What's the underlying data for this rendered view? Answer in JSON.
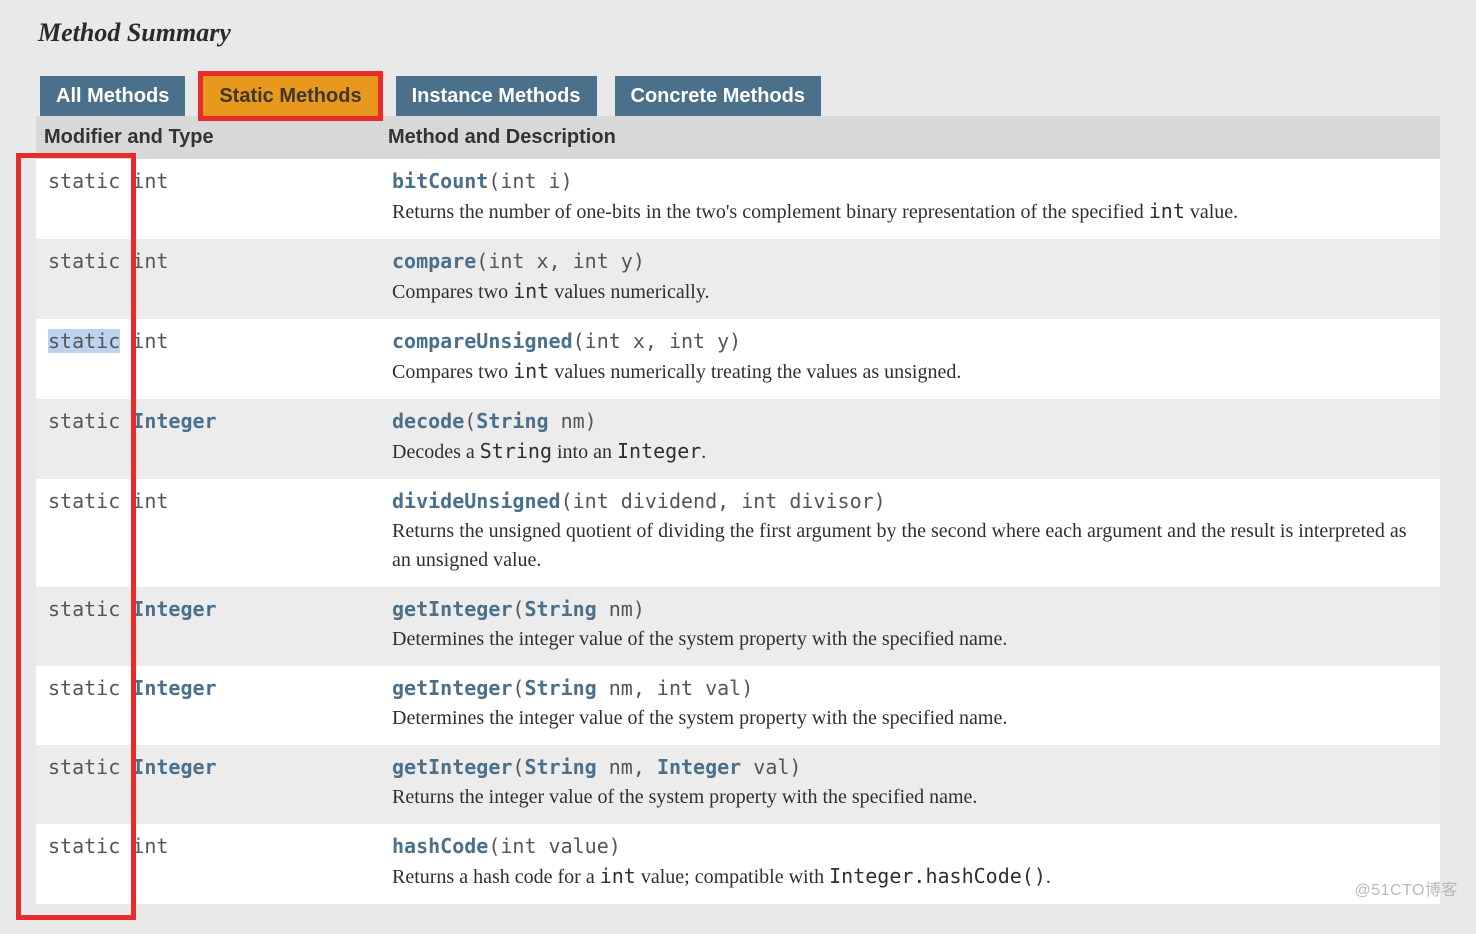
{
  "title": "Method Summary",
  "tabs": [
    {
      "label": "All Methods",
      "active": false
    },
    {
      "label": "Static Methods",
      "active": true,
      "highlight": true
    },
    {
      "label": "Instance Methods",
      "active": false
    },
    {
      "label": "Concrete Methods",
      "active": false
    }
  ],
  "columns": {
    "modifier": "Modifier and Type",
    "method": "Method and Description"
  },
  "rows": [
    {
      "modifier_static": "static",
      "modifier_type": "int",
      "type_is_link": false,
      "method_name": "bitCount",
      "params_html": "(int i)",
      "description_html": "Returns the number of one-bits in the two's complement binary representation of the specified <code>int</code> value."
    },
    {
      "modifier_static": "static",
      "modifier_type": "int",
      "type_is_link": false,
      "method_name": "compare",
      "params_html": "(int x, int y)",
      "description_html": "Compares two <code>int</code> values numerically."
    },
    {
      "modifier_static": "static",
      "static_selected": true,
      "modifier_type": "int",
      "type_is_link": false,
      "method_name": "compareUnsigned",
      "params_html": "(int x, int y)",
      "description_html": "Compares two <code>int</code> values numerically treating the values as unsigned."
    },
    {
      "modifier_static": "static",
      "modifier_type": "Integer",
      "type_is_link": true,
      "method_name": "decode",
      "params_html": "(<span class=\"ptype link\">String</span> nm)",
      "description_html": "Decodes a <code>String</code> into an <code>Integer</code>."
    },
    {
      "modifier_static": "static",
      "modifier_type": "int",
      "type_is_link": false,
      "method_name": "divideUnsigned",
      "params_html": "(int dividend, int divisor)",
      "description_html": "Returns the unsigned quotient of dividing the first argument by the second where each argument and the result is interpreted as an unsigned value."
    },
    {
      "modifier_static": "static",
      "modifier_type": "Integer",
      "type_is_link": true,
      "method_name": "getInteger",
      "params_html": "(<span class=\"ptype link\">String</span> nm)",
      "description_html": "Determines the integer value of the system property with the specified name."
    },
    {
      "modifier_static": "static",
      "modifier_type": "Integer",
      "type_is_link": true,
      "method_name": "getInteger",
      "params_html": "(<span class=\"ptype link\">String</span> nm, int val)",
      "description_html": "Determines the integer value of the system property with the specified name."
    },
    {
      "modifier_static": "static",
      "modifier_type": "Integer",
      "type_is_link": true,
      "method_name": "getInteger",
      "params_html": "(<span class=\"ptype link\">String</span> nm, <span class=\"ptype link\">Integer</span> val)",
      "description_html": "Returns the integer value of the system property with the specified name."
    },
    {
      "modifier_static": "static",
      "modifier_type": "int",
      "type_is_link": false,
      "method_name": "hashCode",
      "params_html": "(int value)",
      "description_html": "Returns a hash code for a <code>int</code> value; compatible with <code>Integer.hashCode()</code>."
    }
  ],
  "annotations": {
    "static_column_box": true
  },
  "watermark": "@51CTO博客"
}
